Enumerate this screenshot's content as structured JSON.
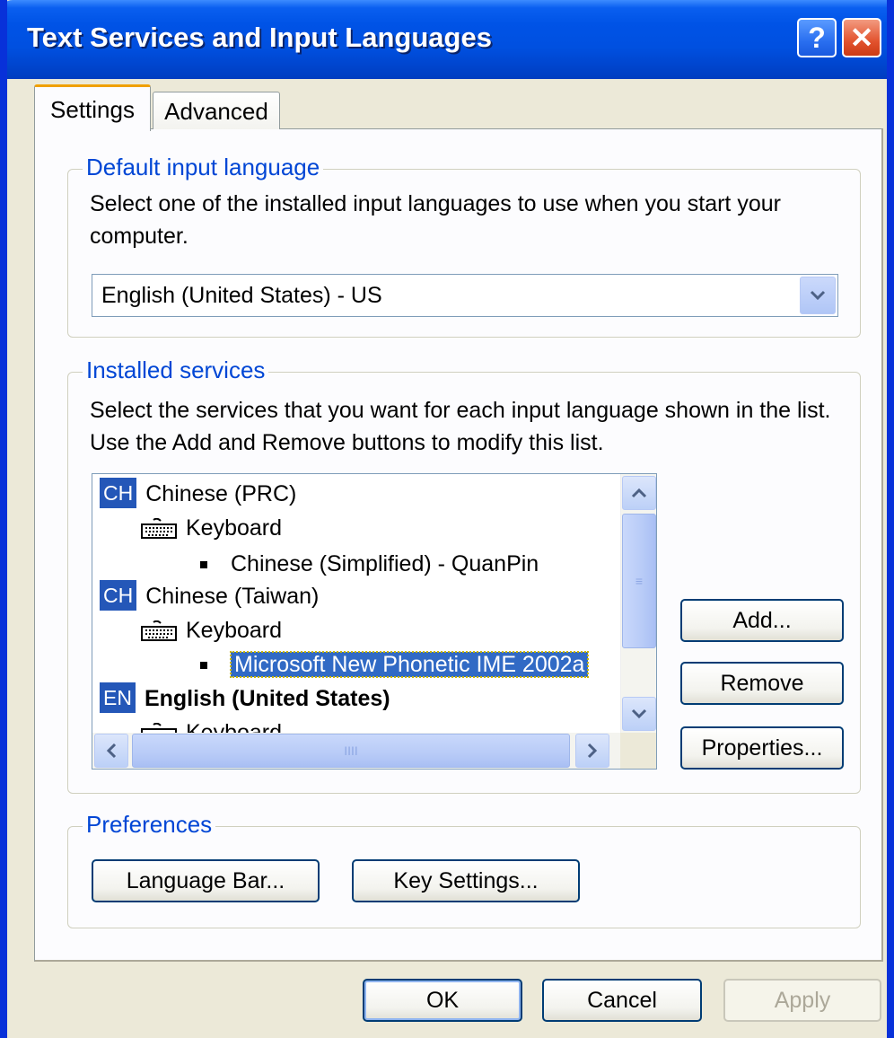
{
  "window": {
    "title": "Text Services and Input Languages"
  },
  "titlebar": {
    "help_glyph": "?",
    "close_glyph": "✕"
  },
  "tabs": [
    {
      "label": "Settings",
      "active": true
    },
    {
      "label": "Advanced",
      "active": false
    }
  ],
  "default_input": {
    "legend": "Default input language",
    "description": "Select one of the installed input languages to use when you start your computer.",
    "selected_value": "English (United States) - US"
  },
  "installed": {
    "legend": "Installed services",
    "description": "Select the services that you want for each input language shown in the list. Use the Add and Remove buttons to modify this list.",
    "tree": [
      {
        "badge": "CH",
        "label": "Chinese (PRC)"
      },
      {
        "label": "Keyboard"
      },
      {
        "label": "Chinese (Simplified) - QuanPin"
      },
      {
        "badge": "CH",
        "label": "Chinese (Taiwan)"
      },
      {
        "label": "Keyboard"
      },
      {
        "label": "Microsoft New Phonetic IME 2002a",
        "selected": true
      },
      {
        "badge": "EN",
        "label": "English (United States)"
      },
      {
        "label": "Keyboard"
      }
    ],
    "buttons": {
      "add": "Add...",
      "remove": "Remove",
      "properties": "Properties..."
    }
  },
  "preferences": {
    "legend": "Preferences",
    "language_bar": "Language Bar...",
    "key_settings": "Key Settings..."
  },
  "footer": {
    "ok": "OK",
    "cancel": "Cancel",
    "apply": "Apply"
  },
  "colors": {
    "title_bar": "#0054e3",
    "accent_blue": "#0046d5",
    "selection": "#316ac5",
    "face": "#ece9d8"
  },
  "icons": {
    "keyboard": "keyboard-icon",
    "help": "help-icon",
    "close": "close-icon"
  }
}
